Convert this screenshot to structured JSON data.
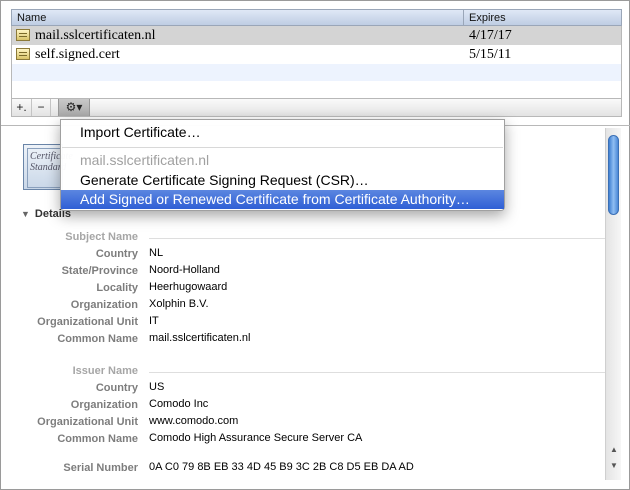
{
  "table": {
    "col_name": "Name",
    "col_expires": "Expires",
    "rows": [
      {
        "name": "mail.sslcertificaten.nl",
        "expires": "4/17/17"
      },
      {
        "name": "self.signed.cert",
        "expires": "5/15/11"
      }
    ]
  },
  "toolbar": {
    "add_label": "+.",
    "remove_label": "−",
    "gear_label": "⚙▾"
  },
  "menu": {
    "import": "Import Certificate…",
    "header": "mail.sslcertificaten.nl",
    "csr": "Generate Certificate Signing Request (CSR)…",
    "signed": "Add Signed or Renewed Certificate from Certificate Authority…"
  },
  "thumb_text": "Certificate Standard",
  "details": {
    "heading": "Details",
    "subject": {
      "title": "Subject Name",
      "fields": [
        {
          "label": "Country",
          "value": "NL"
        },
        {
          "label": "State/Province",
          "value": "Noord-Holland"
        },
        {
          "label": "Locality",
          "value": "Heerhugowaard"
        },
        {
          "label": "Organization",
          "value": "Xolphin B.V."
        },
        {
          "label": "Organizational Unit",
          "value": "IT"
        },
        {
          "label": "Common Name",
          "value": "mail.sslcertificaten.nl"
        }
      ]
    },
    "issuer": {
      "title": "Issuer Name",
      "fields": [
        {
          "label": "Country",
          "value": "US"
        },
        {
          "label": "Organization",
          "value": "Comodo Inc"
        },
        {
          "label": "Organizational Unit",
          "value": "www.comodo.com"
        },
        {
          "label": "Common Name",
          "value": "Comodo High Assurance Secure Server CA"
        }
      ]
    },
    "serial": {
      "label": "Serial Number",
      "value": "0A C0 79 8B EB 33 4D 45 B9 3C 2B C8 D5 EB DA AD"
    }
  },
  "colors": {
    "selection": "#2f5fd5",
    "header": "#bfcde3",
    "scroll_thumb": "#4b88d6"
  },
  "icons": [
    "certificate-icon",
    "gear-icon",
    "disclosure-triangle-icon",
    "scroll-up-arrow-icon",
    "scroll-down-arrow-icon"
  ]
}
